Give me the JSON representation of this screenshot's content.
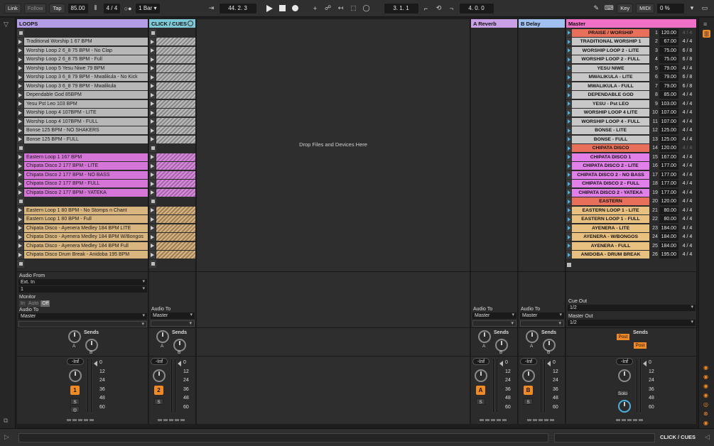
{
  "transport": {
    "link": "Link",
    "follow": "Follow",
    "tap": "Tap",
    "tempo": "85.00",
    "signature": "4 / 4",
    "quantize": "1 Bar",
    "position": "44.  2.  3",
    "loop_start": "3.  1.  1",
    "loop_length": "4.  0.  0",
    "key": "Key",
    "midi": "MIDI",
    "cpu": "0 %"
  },
  "tracks": {
    "loops": {
      "title": "LOOPS",
      "color": "#b39ee6",
      "clips_group1": [
        "Traditional Worship 1 67 BPM",
        "Worship Loop 2 6_8 75 BPM - No Clap",
        "Worship Loop 2 6_8 75 BPM - Full",
        "Worship Loop 5 Yesu Niwe 79 BPM",
        "Worship Loop 3 6_8 79 BPM - Mwalikula - No Kick",
        "Worship Loop 3 6_8 79 BPM - Mwalikula",
        "Dependable God 85BPM",
        "Yesu Pst Leo 103 BPM",
        "Worship Loop 4 107BPM - LITE",
        "Worship Loop 4 107BPM - FULL",
        "Bonse 125 BPM - NO SHAKERS",
        "Bonse 125 BPM - FULL"
      ],
      "clips_group2": [
        "Eastern Loop 1 167 BPM",
        "Chipata Disco 2 177 BPM - LITE",
        "Chipata Disco 2 177 BPM - NO BASS",
        "Chipata Disco 2 177 BPM - FULL",
        "Chipata Disco 2 177 BPM - YATEKA"
      ],
      "clips_group3": [
        "Eastern Loop 1 80 BPM - No Stomps n Chant",
        "Eastern Loop 1 80 BPM - Full",
        "Chipata Disco - Ayenera Medley 184 BPM LITE",
        "Chipata Disco - Ayenera Medley 184 BPM W/Bongos",
        "Chipata Disco - Ayenera Medley 184 BPM Full",
        "Chipata Disco Drum Break - Anidoba 195 BPM"
      ],
      "audio_from_label": "Audio From",
      "audio_from": "Ext. In",
      "audio_from_channel": "1",
      "monitor_label": "Monitor",
      "monitor_in": "In",
      "monitor_auto": "Auto",
      "monitor_off": "Off",
      "audio_to_label": "Audio To",
      "audio_to": "Master",
      "sends_label": "Sends",
      "volume": "-Inf",
      "number": "1",
      "solo": "S"
    },
    "click": {
      "title": "CLICK / CUES",
      "color": "#7ec8d8",
      "audio_to_label": "Audio To",
      "audio_to": "Master",
      "sends_label": "Sends",
      "volume": "-Inf",
      "number": "2",
      "solo": "S"
    },
    "reverb": {
      "title": "A Reverb",
      "color": "#c9a0e6",
      "audio_to_label": "Audio To",
      "audio_to": "Master",
      "sends_label": "Sends",
      "volume": "-Inf",
      "letter": "A",
      "solo": "S"
    },
    "delay": {
      "title": "B Delay",
      "color": "#a0c0f0",
      "audio_to_label": "Audio To",
      "audio_to": "Master",
      "sends_label": "Sends",
      "volume": "-Inf",
      "letter": "B",
      "solo": "S"
    },
    "master": {
      "title": "Master",
      "color": "#f070c8",
      "cue_out_label": "Cue Out",
      "cue_out": "1/2",
      "master_out_label": "Master Out",
      "master_out": "1/2",
      "sends_label": "Sends",
      "post1": "Post",
      "post2": "Post",
      "volume": "-Inf",
      "solo": "Solo"
    }
  },
  "knob_labels": {
    "a": "A",
    "b": "B"
  },
  "meter_scale": [
    "0",
    "12",
    "24",
    "36",
    "48",
    "60"
  ],
  "scenes": [
    {
      "name": "PRAISE / WORSHIP",
      "num": "1",
      "bpm": "120.00",
      "sig": "4 / 4",
      "color": "#e8705a",
      "dimsig": true
    },
    {
      "name": "TRADITIONAL WORSHIP 1",
      "num": "2",
      "bpm": "67.00",
      "sig": "4 / 4",
      "color": "#c8c8c8"
    },
    {
      "name": "WORSHIP LOOP 2 - LITE",
      "num": "3",
      "bpm": "75.00",
      "sig": "6 / 8",
      "color": "#c8c8c8"
    },
    {
      "name": "WORSHIP LOOP 2 - FULL",
      "num": "4",
      "bpm": "75.00",
      "sig": "6 / 8",
      "color": "#c8c8c8"
    },
    {
      "name": "YESU NIWE",
      "num": "5",
      "bpm": "79.00",
      "sig": "4 / 4",
      "color": "#c8c8c8"
    },
    {
      "name": "MWALIKULA - LITE",
      "num": "6",
      "bpm": "79.00",
      "sig": "6 / 8",
      "color": "#c8c8c8"
    },
    {
      "name": "MWALIKULA - FULL",
      "num": "7",
      "bpm": "79.00",
      "sig": "6 / 8",
      "color": "#c8c8c8"
    },
    {
      "name": "DEPENDABLE GOD",
      "num": "8",
      "bpm": "85.00",
      "sig": "4 / 4",
      "color": "#c8c8c8"
    },
    {
      "name": "YESU - Pst LEO",
      "num": "9",
      "bpm": "103.00",
      "sig": "4 / 4",
      "color": "#c8c8c8"
    },
    {
      "name": "WORSHIP LOOP 4 LITE",
      "num": "10",
      "bpm": "107.00",
      "sig": "4 / 4",
      "color": "#c8c8c8"
    },
    {
      "name": "WORSHIP LOOP 4 - FULL",
      "num": "11",
      "bpm": "107.00",
      "sig": "4 / 4",
      "color": "#c8c8c8"
    },
    {
      "name": "BONSE - LITE",
      "num": "12",
      "bpm": "125.00",
      "sig": "4 / 4",
      "color": "#c8c8c8"
    },
    {
      "name": "BONSE - FULL",
      "num": "13",
      "bpm": "125.00",
      "sig": "4 / 4",
      "color": "#c8c8c8"
    },
    {
      "name": "CHIPATA DISCO",
      "num": "14",
      "bpm": "120.00",
      "sig": "4 / 4",
      "color": "#e8705a",
      "dimsig": true
    },
    {
      "name": "CHIPATA DISCO 1",
      "num": "15",
      "bpm": "167.00",
      "sig": "4 / 4",
      "color": "#e080e8"
    },
    {
      "name": "CHIPATA DISCO 2 - LITE",
      "num": "16",
      "bpm": "177.00",
      "sig": "4 / 4",
      "color": "#e080e8"
    },
    {
      "name": "CHIPATA DISCO 2 - NO BASS",
      "num": "17",
      "bpm": "177.00",
      "sig": "4 / 4",
      "color": "#e080e8"
    },
    {
      "name": "CHIPATA DISCO 2 - FULL",
      "num": "18",
      "bpm": "177.00",
      "sig": "4 / 4",
      "color": "#e080e8"
    },
    {
      "name": "CHIPATA DISCO 2 - YATEKA",
      "num": "19",
      "bpm": "177.00",
      "sig": "4 / 4",
      "color": "#e080e8"
    },
    {
      "name": "EASTERN",
      "num": "20",
      "bpm": "120.00",
      "sig": "4 / 4",
      "color": "#e8705a"
    },
    {
      "name": "EASTERN LOOP 1 - LITE",
      "num": "21",
      "bpm": "80.00",
      "sig": "4 / 4",
      "color": "#e8c080"
    },
    {
      "name": "EASTERN LOOP 1 - FULL",
      "num": "22",
      "bpm": "80.00",
      "sig": "4 / 4",
      "color": "#e8c080"
    },
    {
      "name": "AYENERA - LITE",
      "num": "23",
      "bpm": "184.00",
      "sig": "4 / 4",
      "color": "#e8c080"
    },
    {
      "name": "AYENERA - W/BONGOS",
      "num": "24",
      "bpm": "184.00",
      "sig": "4 / 4",
      "color": "#e8c080"
    },
    {
      "name": "AYENERA - FULL",
      "num": "25",
      "bpm": "184.00",
      "sig": "4 / 4",
      "color": "#e8c080"
    },
    {
      "name": "ANIDOBA - DRUM BREAK",
      "num": "26",
      "bpm": "195.00",
      "sig": "4 / 4",
      "color": "#e8c080"
    }
  ],
  "dropzone": {
    "text": "Drop Files and Devices Here"
  },
  "bottom": {
    "selected_track": "CLICK / CUES"
  }
}
